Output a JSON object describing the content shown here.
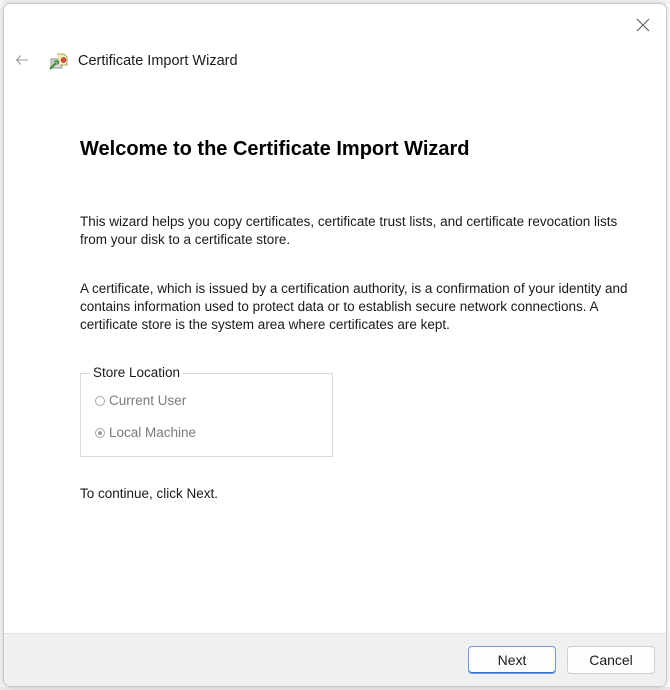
{
  "dialog": {
    "title": "Certificate Import Wizard",
    "heading": "Welcome to the Certificate Import Wizard",
    "paragraph1": "This wizard helps you copy certificates, certificate trust lists, and certificate revocation lists from your disk to a certificate store.",
    "paragraph2": "A certificate, which is issued by a certification authority, is a confirmation of your identity and contains information used to protect data or to establish secure network connections. A certificate store is the system area where certificates are kept.",
    "store_location": {
      "legend": "Store Location",
      "options": [
        {
          "label": "Current User",
          "selected": false,
          "enabled": false
        },
        {
          "label": "Local Machine",
          "selected": true,
          "enabled": false
        }
      ]
    },
    "continue_text": "To continue, click Next.",
    "buttons": {
      "next": "Next",
      "cancel": "Cancel"
    }
  },
  "icons": {
    "close": "close-icon",
    "back": "back-arrow-icon",
    "wizard": "certificate-wizard-icon"
  },
  "colors": {
    "accent": "#2f6fc9",
    "footer": "#f0f0f0"
  }
}
